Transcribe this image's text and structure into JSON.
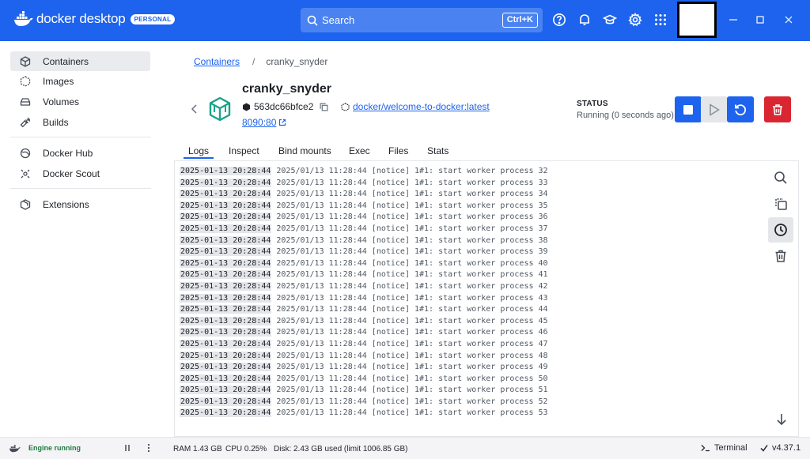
{
  "app": {
    "name": "docker desktop",
    "badge": "PERSONAL"
  },
  "search": {
    "placeholder": "Search",
    "shortcut": "Ctrl+K"
  },
  "sidebar": {
    "items": [
      {
        "label": "Containers",
        "icon": "container-icon",
        "active": true
      },
      {
        "label": "Images",
        "icon": "image-icon"
      },
      {
        "label": "Volumes",
        "icon": "volume-icon"
      },
      {
        "label": "Builds",
        "icon": "wrench-icon"
      },
      {
        "label": "Docker Hub",
        "icon": "hub-icon"
      },
      {
        "label": "Docker Scout",
        "icon": "scout-icon"
      },
      {
        "label": "Extensions",
        "icon": "extensions-icon"
      }
    ]
  },
  "breadcrumb": {
    "root": "Containers",
    "separator": "/",
    "current": "cranky_snyder"
  },
  "container": {
    "name": "cranky_snyder",
    "id": "563dc66bfce2",
    "image": "docker/welcome-to-docker:latest",
    "port": "8090:80",
    "status_label": "STATUS",
    "status_value": "Running (0 seconds ago)"
  },
  "tabs": [
    {
      "label": "Logs",
      "active": true
    },
    {
      "label": "Inspect"
    },
    {
      "label": "Bind mounts"
    },
    {
      "label": "Exec"
    },
    {
      "label": "Files"
    },
    {
      "label": "Stats"
    }
  ],
  "logs": [
    {
      "ts": "2025-01-13 20:28:44",
      "msg": "2025/01/13 11:28:44 [notice] 1#1: start worker process 32"
    },
    {
      "ts": "2025-01-13 20:28:44",
      "msg": "2025/01/13 11:28:44 [notice] 1#1: start worker process 33"
    },
    {
      "ts": "2025-01-13 20:28:44",
      "msg": "2025/01/13 11:28:44 [notice] 1#1: start worker process 34"
    },
    {
      "ts": "2025-01-13 20:28:44",
      "msg": "2025/01/13 11:28:44 [notice] 1#1: start worker process 35"
    },
    {
      "ts": "2025-01-13 20:28:44",
      "msg": "2025/01/13 11:28:44 [notice] 1#1: start worker process 36"
    },
    {
      "ts": "2025-01-13 20:28:44",
      "msg": "2025/01/13 11:28:44 [notice] 1#1: start worker process 37"
    },
    {
      "ts": "2025-01-13 20:28:44",
      "msg": "2025/01/13 11:28:44 [notice] 1#1: start worker process 38"
    },
    {
      "ts": "2025-01-13 20:28:44",
      "msg": "2025/01/13 11:28:44 [notice] 1#1: start worker process 39"
    },
    {
      "ts": "2025-01-13 20:28:44",
      "msg": "2025/01/13 11:28:44 [notice] 1#1: start worker process 40"
    },
    {
      "ts": "2025-01-13 20:28:44",
      "msg": "2025/01/13 11:28:44 [notice] 1#1: start worker process 41"
    },
    {
      "ts": "2025-01-13 20:28:44",
      "msg": "2025/01/13 11:28:44 [notice] 1#1: start worker process 42"
    },
    {
      "ts": "2025-01-13 20:28:44",
      "msg": "2025/01/13 11:28:44 [notice] 1#1: start worker process 43"
    },
    {
      "ts": "2025-01-13 20:28:44",
      "msg": "2025/01/13 11:28:44 [notice] 1#1: start worker process 44"
    },
    {
      "ts": "2025-01-13 20:28:44",
      "msg": "2025/01/13 11:28:44 [notice] 1#1: start worker process 45"
    },
    {
      "ts": "2025-01-13 20:28:44",
      "msg": "2025/01/13 11:28:44 [notice] 1#1: start worker process 46"
    },
    {
      "ts": "2025-01-13 20:28:44",
      "msg": "2025/01/13 11:28:44 [notice] 1#1: start worker process 47"
    },
    {
      "ts": "2025-01-13 20:28:44",
      "msg": "2025/01/13 11:28:44 [notice] 1#1: start worker process 48"
    },
    {
      "ts": "2025-01-13 20:28:44",
      "msg": "2025/01/13 11:28:44 [notice] 1#1: start worker process 49"
    },
    {
      "ts": "2025-01-13 20:28:44",
      "msg": "2025/01/13 11:28:44 [notice] 1#1: start worker process 50"
    },
    {
      "ts": "2025-01-13 20:28:44",
      "msg": "2025/01/13 11:28:44 [notice] 1#1: start worker process 51"
    },
    {
      "ts": "2025-01-13 20:28:44",
      "msg": "2025/01/13 11:28:44 [notice] 1#1: start worker process 52"
    },
    {
      "ts": "2025-01-13 20:28:44",
      "msg": "2025/01/13 11:28:44 [notice] 1#1: start worker process 53"
    }
  ],
  "footer": {
    "engine_status": "Engine running",
    "ram": "RAM 1.43 GB",
    "cpu": "CPU 0.25%",
    "disk": "Disk: 2.43 GB used (limit 1006.85 GB)",
    "terminal": "Terminal",
    "version": "v4.37.1"
  },
  "colors": {
    "brand": "#1d63ed",
    "danger": "#d92630",
    "running": "#1e7a3e"
  }
}
